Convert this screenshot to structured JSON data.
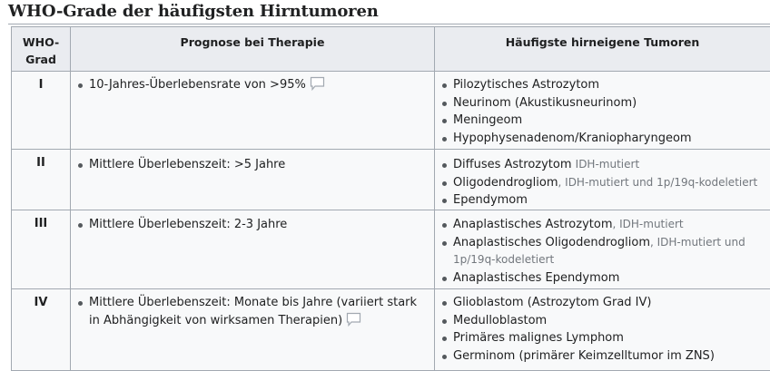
{
  "title": "WHO-Grade der häufigsten Hirntumoren",
  "headers": {
    "grade_line1": "WHO-",
    "grade_line2": "Grad",
    "prognosis": "Prognose bei Therapie",
    "tumors": "Häufigste hirneigene Tumoren"
  },
  "rows": [
    {
      "grade": "I",
      "prognosis": "10-Jahres-Überlebensrate von >95%",
      "tumors": [
        {
          "name": "Pilozytisches Astrozytom",
          "note": ""
        },
        {
          "name": "Neurinom (Akustikusneurinom)",
          "note": ""
        },
        {
          "name": "Meningeom",
          "note": ""
        },
        {
          "name": "Hypophysenadenom/Kraniopharyngeom",
          "note": ""
        }
      ]
    },
    {
      "grade": "II",
      "prognosis": "Mittlere Überlebenszeit: >5 Jahre",
      "tumors": [
        {
          "name": "Diffuses Astrozytom",
          "note": "IDH-mutiert"
        },
        {
          "name": "Oligodendrogliom",
          "note": "IDH-mutiert und 1p/19q-kodeletiert"
        },
        {
          "name": "Ependymom",
          "note": ""
        }
      ]
    },
    {
      "grade": "III",
      "prognosis": "Mittlere Überlebenszeit: 2-3 Jahre",
      "tumors": [
        {
          "name": "Anaplastisches Astrozytom",
          "note": "IDH-mutiert"
        },
        {
          "name": "Anaplastisches Oligodendrogliom",
          "note": "IDH-mutiert und 1p/19q-kodeletiert"
        },
        {
          "name": "Anaplastisches Ependymom",
          "note": ""
        }
      ]
    },
    {
      "grade": "IV",
      "prognosis": "Mittlere Überlebenszeit: Monate bis Jahre (variiert stark in Abhängigkeit von wirksamen Therapien)",
      "tumors": [
        {
          "name": "Glioblastom (Astrozytom Grad IV)",
          "note": ""
        },
        {
          "name": "Medulloblastom",
          "note": ""
        },
        {
          "name": "Primäres malignes Lymphom",
          "note": ""
        },
        {
          "name": "Germinom (primärer Keimzelltumor im ZNS)",
          "note": ""
        }
      ]
    }
  ]
}
